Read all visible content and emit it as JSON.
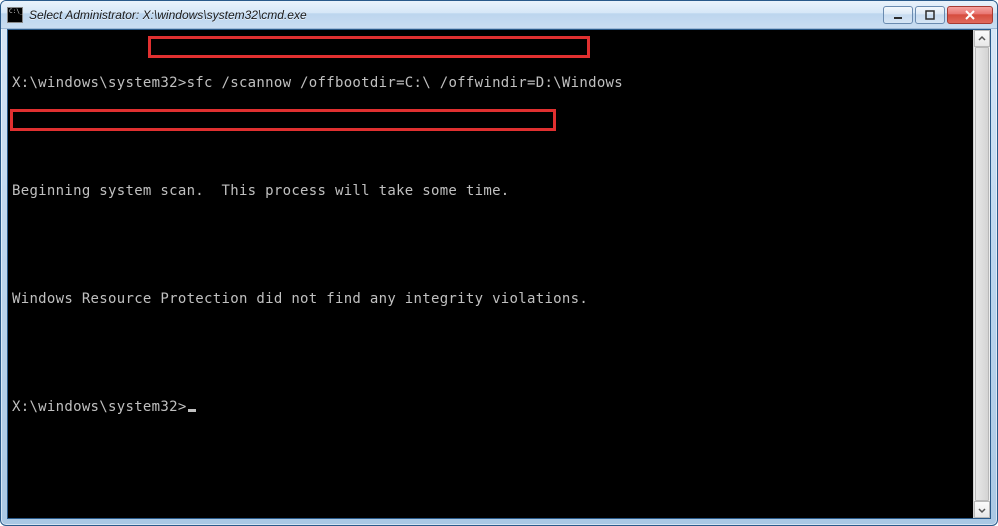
{
  "window": {
    "title": "Select Administrator: X:\\windows\\system32\\cmd.exe"
  },
  "console": {
    "prompt1": "X:\\windows\\system32>",
    "command": "sfc /scannow /offbootdir=C:\\ /offwindir=D:\\Windows",
    "line_scan": "Beginning system scan.  This process will take some time.",
    "line_result": "Windows Resource Protection did not find any integrity violations.",
    "prompt2": "X:\\windows\\system32>"
  },
  "highlights": [
    {
      "name": "command-highlight"
    },
    {
      "name": "result-highlight"
    }
  ]
}
